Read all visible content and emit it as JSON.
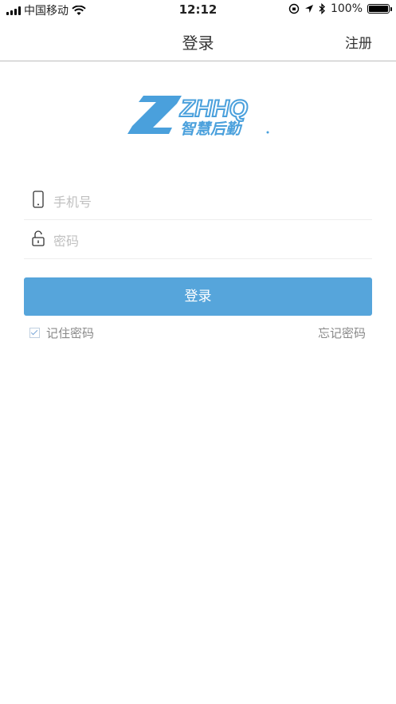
{
  "status_bar": {
    "carrier": "中国移动",
    "time": "12:12",
    "battery": "100%"
  },
  "nav": {
    "title": "登录",
    "register": "注册"
  },
  "logo": {
    "text": "ZHHQ",
    "tagline": "智慧后勤",
    "color": "#4aa0dc"
  },
  "form": {
    "phone_placeholder": "手机号",
    "password_placeholder": "密码",
    "login_button": "登录",
    "remember_label": "记住密码",
    "remember_checked": true,
    "forgot_link": "忘记密码"
  },
  "colors": {
    "primary": "#56a5db"
  }
}
